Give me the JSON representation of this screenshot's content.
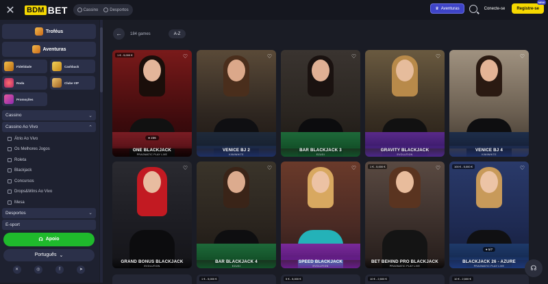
{
  "header": {
    "logo_bdm": "BDM",
    "logo_bet": "BET",
    "nav": [
      {
        "label": "Cassino"
      },
      {
        "label": "Desportos"
      }
    ],
    "aventuras": "Aventuras",
    "login": "Conecte-se",
    "register": "Registre-se",
    "register_badge": "NEW"
  },
  "sidebar": {
    "trofeus": "Troféus",
    "aventuras": "Aventuras",
    "tiles": [
      {
        "label": "Fidelidade"
      },
      {
        "label": "Cashback"
      },
      {
        "label": "Roda"
      },
      {
        "label": "Clube VIP"
      },
      {
        "label": "Promoções"
      }
    ],
    "casino": "Cassino",
    "casino_live": "Cassino Ao Vivo",
    "sub_items": [
      {
        "label": "Átrio Ao Vivo"
      },
      {
        "label": "Os Melhores Jogos"
      },
      {
        "label": "Roleta"
      },
      {
        "label": "Blackjack"
      },
      {
        "label": "Concursos"
      },
      {
        "label": "Drops&Wins Ao Vivo"
      },
      {
        "label": "Mesa"
      }
    ],
    "sports": "Desportos",
    "esport": "E-sport",
    "support": "Apoio",
    "language": "Português"
  },
  "main": {
    "games_count": "184 games",
    "sort": "A-Z"
  },
  "games": [
    {
      "title": "One Blackjack",
      "provider": "PRAGMATIC PLAY LIVE",
      "limit": "1 € - 5,000 €",
      "players": "236"
    },
    {
      "title": "Venice BJ 2",
      "provider": "KIWIWHITE"
    },
    {
      "title": "Bar Blackjack 3",
      "provider": "EZUGI"
    },
    {
      "title": "Gravity Blackjack",
      "provider": "EVOLUTION"
    },
    {
      "title": "Venice BJ 4",
      "provider": "KIWIWHITE"
    },
    {
      "title": "Grand Bonus Blackjack",
      "provider": "EVOLUTION"
    },
    {
      "title": "Bar Blackjack 4",
      "provider": "EZUGI"
    },
    {
      "title": "Speed Blackjack",
      "provider": "EVOLUTION"
    },
    {
      "title": "Bet Behind Pro Blackjack",
      "provider": "PRAGMATIC PLAY LIVE",
      "limit": "1 € - 5,000 €"
    },
    {
      "title": "Blackjack 26 - Azure",
      "provider": "PRAGMATIC PLAY LIVE",
      "limit": "100 € - 5,000 €",
      "players": "5/7"
    }
  ],
  "row3_limits": [
    "1 € - 5,000 €",
    "5 € - 5,000 €",
    "10 € - 2,500 €",
    "10 € - 2,500 €"
  ]
}
